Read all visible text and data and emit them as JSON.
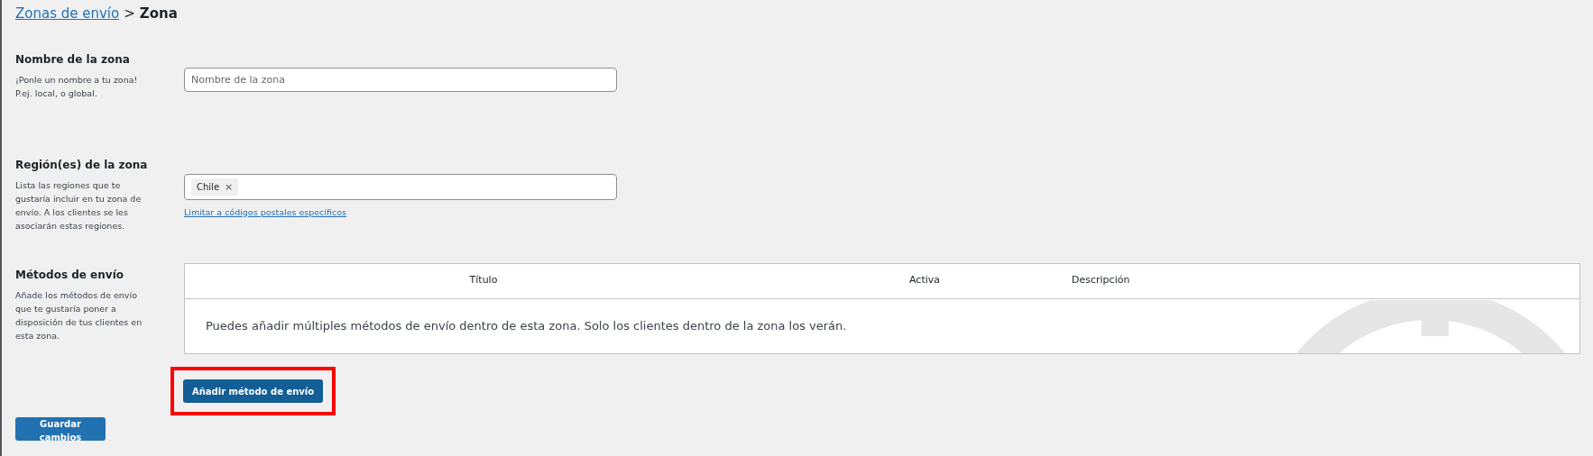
{
  "breadcrumb": {
    "link": "Zonas de envío",
    "separator": ">",
    "current": "Zona"
  },
  "sections": [
    {
      "kind": "text",
      "title": "Nombre de la zona",
      "description": "¡Ponle un nombre a tu zona! P.ej. local, o global.",
      "placeholder": "Nombre de la zona"
    },
    {
      "kind": "tags",
      "title": "Región(es) de la zona",
      "description": "Lista las regiones que te gustaría incluir en tu zona de envío. A los clientes se les asociarán estas regiones.",
      "tags": [
        {
          "label": "Chile",
          "remove": "×"
        }
      ],
      "link": "Limitar a códigos postales específicos"
    },
    {
      "kind": "table",
      "title": "Métodos de envío",
      "description": "Añade los métodos de envío que te gustaría poner a disposición de tus clientes en esta zona.",
      "columns": [
        "Título",
        "Activa",
        "Descripción"
      ],
      "empty_message": "Puedes añadir múltiples métodos de envío dentro de esta zona. Solo los clientes dentro de la zona los verán.",
      "button": {
        "label": "Añadir método de envío",
        "highlighted": true
      }
    }
  ],
  "save_button": "Guardar cambios"
}
